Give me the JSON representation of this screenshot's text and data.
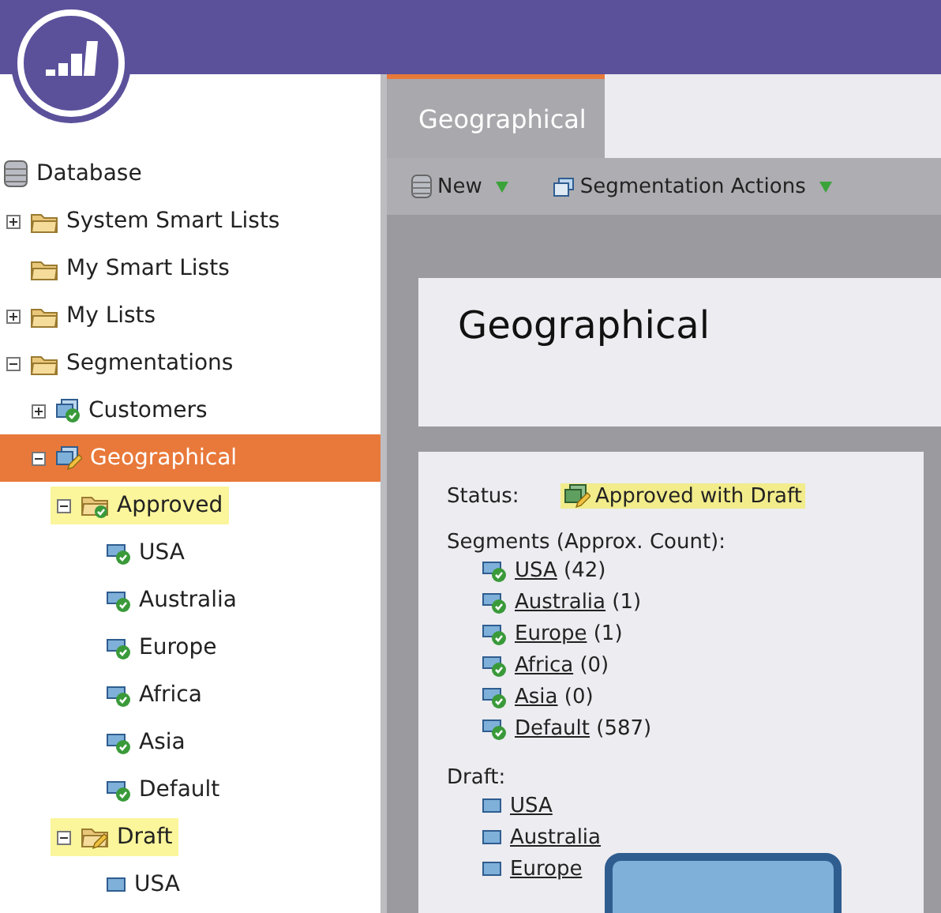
{
  "tree": [
    {
      "label": "Database",
      "kind": "database",
      "selected": false,
      "children": [
        {
          "label": "System Smart Lists",
          "kind": "folder",
          "selected": false,
          "expanded": false
        },
        {
          "label": "My Smart Lists",
          "kind": "folder",
          "selected": false
        },
        {
          "label": "My Lists",
          "kind": "folder",
          "selected": false,
          "expanded": false
        },
        {
          "label": "Segmentations",
          "kind": "folder",
          "selected": false,
          "expanded": true,
          "children": [
            {
              "label": "Customers",
              "kind": "segmentation",
              "selected": false,
              "expanded": false
            },
            {
              "label": "Geographical",
              "kind": "segmentation-draft",
              "selected": true,
              "expanded": true,
              "children": [
                {
                  "label": "Approved",
                  "kind": "approved-folder",
                  "selected": false,
                  "highlighted": true,
                  "expanded": true,
                  "children": [
                    {
                      "label": "USA",
                      "kind": "segment",
                      "selected": false
                    },
                    {
                      "label": "Australia",
                      "kind": "segment",
                      "selected": false
                    },
                    {
                      "label": "Europe",
                      "kind": "segment",
                      "selected": false
                    },
                    {
                      "label": "Africa",
                      "kind": "segment",
                      "selected": false
                    },
                    {
                      "label": "Asia",
                      "kind": "segment",
                      "selected": false
                    },
                    {
                      "label": "Default",
                      "kind": "segment",
                      "selected": false
                    }
                  ]
                },
                {
                  "label": "Draft",
                  "kind": "draft-folder",
                  "selected": false,
                  "highlighted": true,
                  "expanded": true,
                  "children": [
                    {
                      "label": "USA",
                      "kind": "draft-segment",
                      "selected": false
                    }
                  ]
                }
              ]
            }
          ]
        }
      ]
    }
  ],
  "tabs": [
    {
      "label": "Geographical",
      "selected": true
    }
  ],
  "toolbar": [
    {
      "label": "New",
      "kind": "database"
    },
    {
      "label": "Segmentation Actions",
      "kind": "windows"
    }
  ],
  "title": "Geographical",
  "status": {
    "label": "Status:",
    "value": "Approved with Draft"
  },
  "segments": {
    "heading": "Segments (Approx. Count):",
    "items": [
      {
        "name": "USA",
        "count": "(42)"
      },
      {
        "name": "Australia",
        "count": "(1)"
      },
      {
        "name": "Europe",
        "count": "(1)"
      },
      {
        "name": "Africa",
        "count": "(0)"
      },
      {
        "name": "Asia",
        "count": "(0)"
      },
      {
        "name": "Default",
        "count": "(587)"
      }
    ]
  },
  "draft": {
    "heading": "Draft:",
    "items": [
      "USA",
      "Australia",
      "Europe"
    ]
  }
}
